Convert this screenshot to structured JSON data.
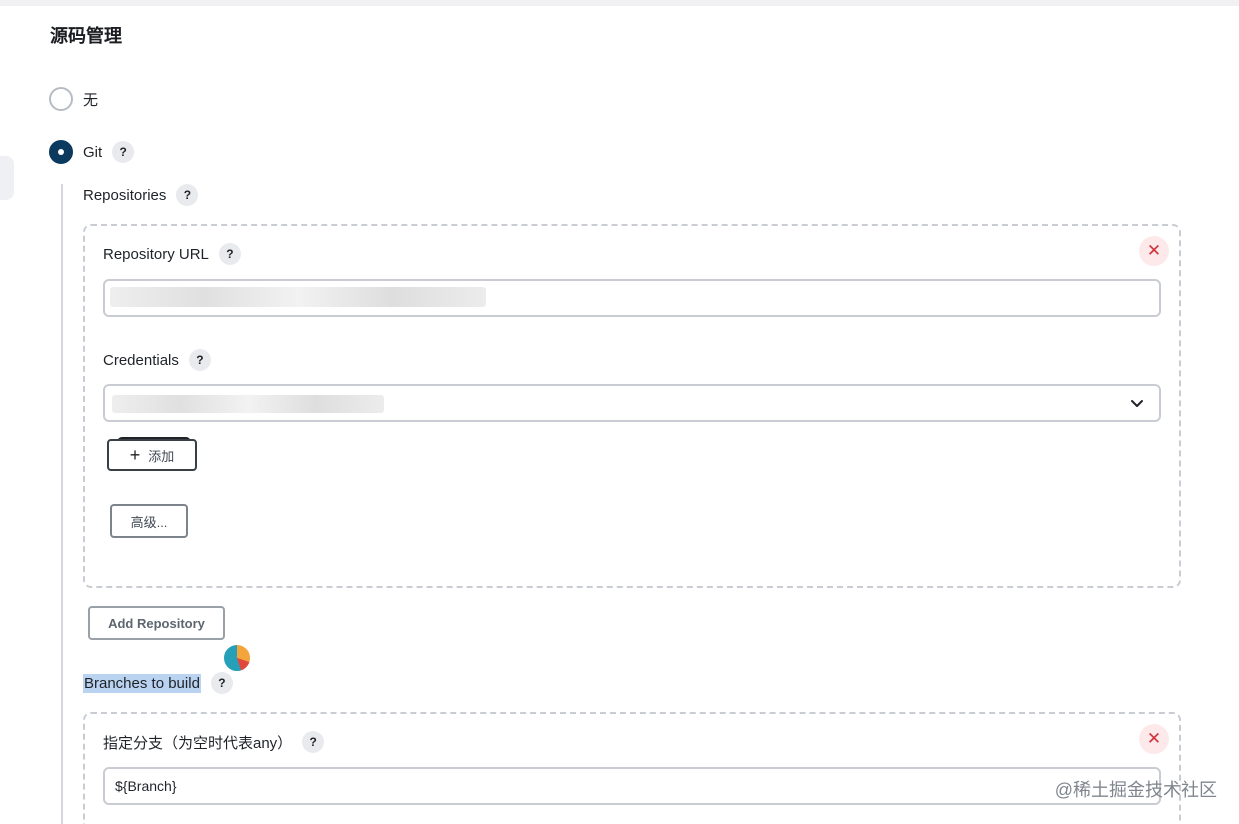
{
  "section_title": "源码管理",
  "scm_options": {
    "none_label": "无",
    "git_label": "Git"
  },
  "help_glyph": "?",
  "repositories": {
    "label": "Repositories",
    "repository_url_label": "Repository URL",
    "repository_url_value": "",
    "credentials_label": "Credentials",
    "credentials_value": "",
    "add_credential_label": "添加",
    "advanced_label": "高级...",
    "remove_glyph": "✕",
    "add_repository_label": "Add Repository"
  },
  "branches": {
    "label": "Branches to build",
    "branch_specifier_label": "指定分支（为空时代表any）",
    "branch_specifier_value": "${Branch}",
    "remove_glyph": "✕"
  },
  "watermark": "@稀土掘金技术社区",
  "colors": {
    "radio_checked": "#0b3a5e",
    "remove_bg": "#fde9ea",
    "remove_fg": "#d32f3a",
    "selection_highlight": "#b9d3f1"
  },
  "icons": {
    "add": "plus-icon",
    "dropdown": "chevron-down-icon",
    "remove": "close-icon",
    "help": "help-icon"
  }
}
